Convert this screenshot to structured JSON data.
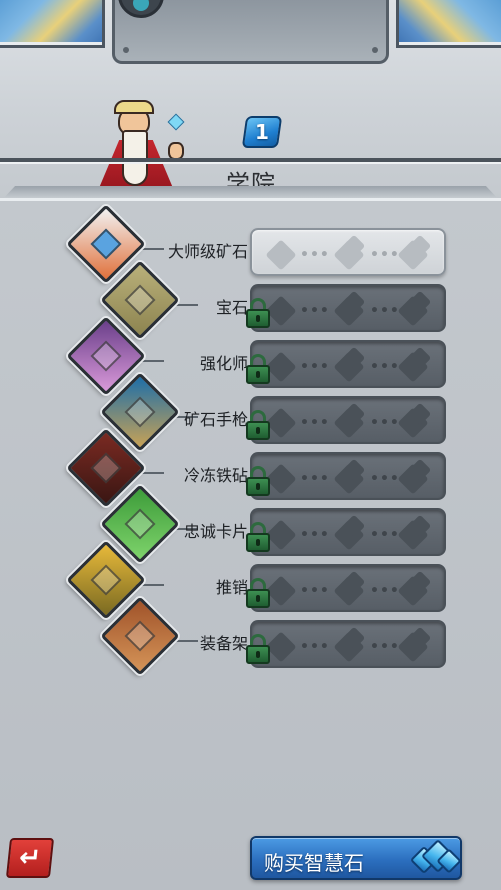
{
  "header": {
    "title": "学院",
    "level": "1"
  },
  "upgrades": [
    {
      "name": "大师级矿石",
      "locked": false,
      "icon": "master-ore-icon",
      "colors": [
        "#f2f2f2",
        "#e0703a",
        "#5aa3e0"
      ]
    },
    {
      "name": "宝石",
      "locked": true,
      "icon": "gem-icon",
      "colors": [
        "#b9b07a",
        "#8d8450"
      ]
    },
    {
      "name": "强化师",
      "locked": true,
      "icon": "star-compass-icon",
      "colors": [
        "#6a3f8a",
        "#d999d9"
      ]
    },
    {
      "name": "矿石手枪",
      "locked": true,
      "icon": "ore-pistol-icon",
      "colors": [
        "#1d6ea8",
        "#c8a256"
      ]
    },
    {
      "name": "冷冻铁砧",
      "locked": true,
      "icon": "frozen-anvil-icon",
      "colors": [
        "#7a2a22",
        "#3a1613"
      ]
    },
    {
      "name": "忠诚卡片",
      "locked": true,
      "icon": "loyalty-card-icon",
      "colors": [
        "#3d9c3a",
        "#7ed36b"
      ]
    },
    {
      "name": "推销",
      "locked": true,
      "icon": "coin-stack-icon",
      "colors": [
        "#e7b93a",
        "#7a6a22"
      ]
    },
    {
      "name": "装备架",
      "locked": true,
      "icon": "equipment-rack-icon",
      "colors": [
        "#a0532a",
        "#d59458"
      ]
    }
  ],
  "footer": {
    "back_symbol": "↵",
    "buy_label": "购买智慧石"
  }
}
